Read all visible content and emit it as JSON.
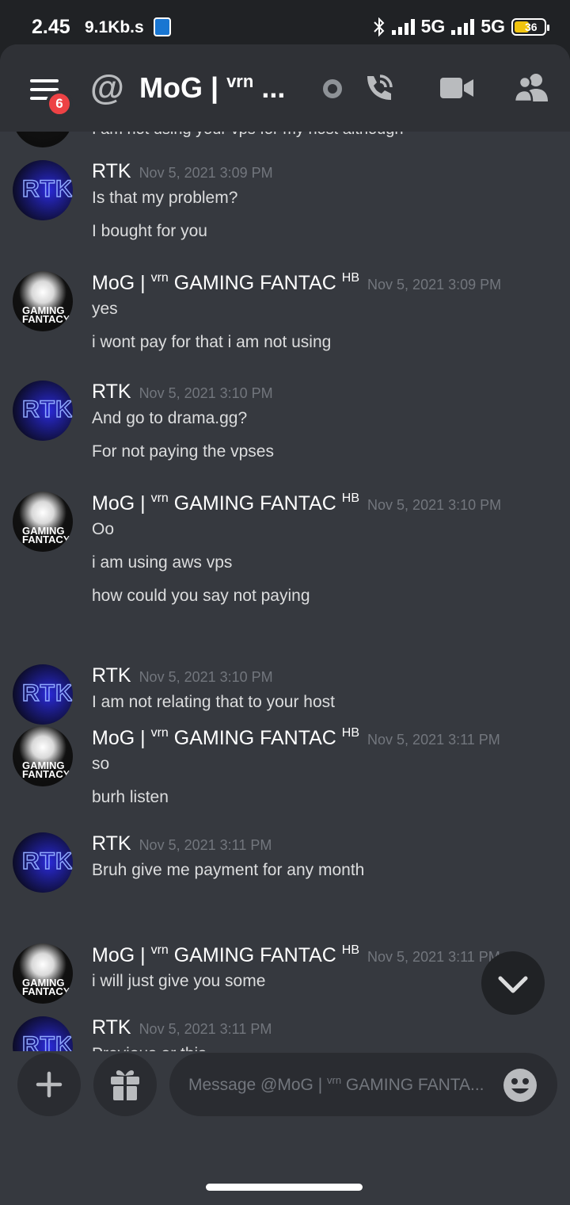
{
  "statusbar": {
    "time": "2.45",
    "speed": "9.1Kb.s",
    "net1": "5G",
    "net2": "5G",
    "battery": "36"
  },
  "header": {
    "title_prefix": "MoG | ",
    "title_sup": "vrn",
    "title_suffix": " ...",
    "unread_badge": "6",
    "at_symbol": "@"
  },
  "cutoff_line": "I am not using your vps for my host although",
  "messages": [
    {
      "author": "RTK",
      "author_sup": "",
      "author_tag": "",
      "timestamp": "Nov 5, 2021 3:09 PM",
      "avatar_text": "RTK",
      "lines": [
        "Is that my problem?",
        "I bought for you"
      ]
    },
    {
      "author": "MoG | ",
      "author_sup": "vrn",
      "author_rest": " GAMING FANTAC ",
      "author_tag": "HB",
      "timestamp": "Nov 5, 2021 3:09 PM",
      "avatar_text": "GAMING FANTACY",
      "lines": [
        "yes",
        "i wont pay for that i am not using"
      ]
    },
    {
      "author": "RTK",
      "author_sup": "",
      "author_tag": "",
      "timestamp": "Nov 5, 2021 3:10 PM",
      "avatar_text": "RTK",
      "lines": [
        "And go to drama.gg?",
        "For not paying the vpses"
      ]
    },
    {
      "author": "MoG | ",
      "author_sup": "vrn",
      "author_rest": " GAMING FANTAC ",
      "author_tag": "HB",
      "timestamp": "Nov 5, 2021 3:10 PM",
      "avatar_text": "GAMING FANTACY",
      "lines": [
        "Oo",
        "i am using aws vps",
        "how could you say not paying"
      ]
    },
    {
      "author": "RTK",
      "author_sup": "",
      "author_tag": "",
      "timestamp": "Nov 5, 2021 3:10 PM",
      "avatar_text": "RTK",
      "lines": [
        "I am not relating that to your host"
      ]
    },
    {
      "author": "MoG | ",
      "author_sup": "vrn",
      "author_rest": " GAMING FANTAC ",
      "author_tag": "HB",
      "timestamp": "Nov 5, 2021 3:11 PM",
      "avatar_text": "GAMING FANTACY",
      "lines": [
        "so",
        "burh listen"
      ]
    },
    {
      "author": "RTK",
      "author_sup": "",
      "author_tag": "",
      "timestamp": "Nov 5, 2021 3:11 PM",
      "avatar_text": "RTK",
      "lines": [
        "Bruh give me payment for any month"
      ]
    },
    {
      "author": "MoG | ",
      "author_sup": "vrn",
      "author_rest": " GAMING FANTAC ",
      "author_tag": "HB",
      "timestamp": "Nov 5, 2021 3:11 PM",
      "avatar_text": "GAMING FANTACY",
      "lines": [
        "i will just give you some"
      ]
    },
    {
      "author": "RTK",
      "author_sup": "",
      "author_tag": "",
      "timestamp": "Nov 5, 2021 3:11 PM",
      "avatar_text": "RTK",
      "lines": [
        "Previous or this"
      ]
    }
  ],
  "composer": {
    "placeholder_prefix": "Message @MoG | ",
    "placeholder_sup": "vrn",
    "placeholder_rest": " GAMING FANTA..."
  },
  "icons": {
    "menu": "hamburger-menu-icon",
    "call": "phone-call-icon",
    "video": "video-camera-icon",
    "members": "members-icon",
    "jump": "chevron-down-icon",
    "add": "plus-icon",
    "gift": "gift-icon",
    "emoji": "emoji-smile-icon"
  }
}
